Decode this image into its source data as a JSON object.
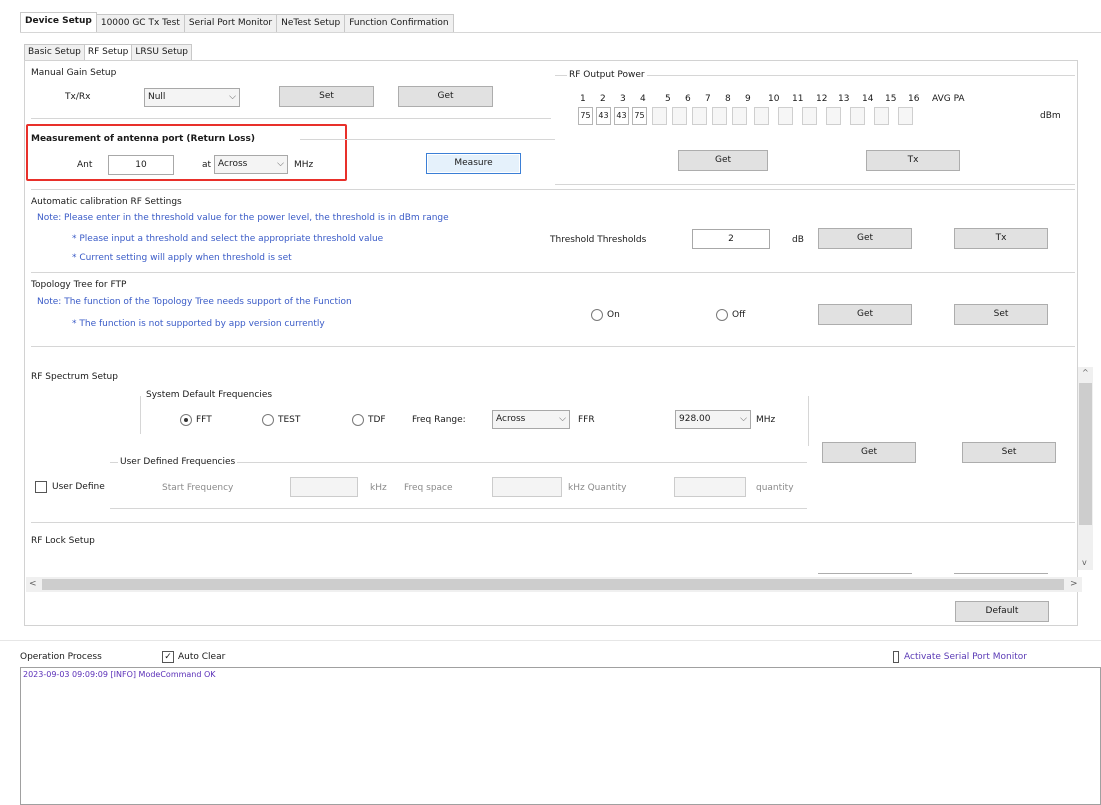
{
  "main_tabs": [
    "Device Setup",
    "10000 GC Tx Test",
    "Serial Port Monitor",
    "NeTest Setup",
    "Function Confirmation"
  ],
  "sub_tabs": [
    "Basic Setup",
    "RF Setup",
    "LRSU Setup"
  ],
  "manual_gain": {
    "title": "Manual Gain Setup",
    "field_label": "Tx/Rx",
    "combo_value": "Null",
    "set_label": "Set",
    "get_label": "Get"
  },
  "output_power": {
    "title": "RF Output Power",
    "numbers": [
      "1",
      "2",
      "3",
      "4",
      "5",
      "6",
      "7",
      "8",
      "9",
      "10",
      "11",
      "12",
      "13",
      "14",
      "15",
      "16"
    ],
    "last_label": "AVG PA",
    "unit": "dBm",
    "values": [
      "75",
      "43",
      "43",
      "75",
      "",
      "",
      "",
      "",
      "",
      "",
      "",
      "",
      "",
      "",
      "",
      ""
    ],
    "get_label": "Get",
    "set_label": "Tx"
  },
  "measurement": {
    "title": "Measurement of antenna port (Return Loss)",
    "prefix": "Ant",
    "value": "10",
    "at_label": "at",
    "combo_value": "Across",
    "unit": "MHz",
    "button": "Measure"
  },
  "automatic": {
    "title": "Automatic calibration RF Settings",
    "note_prefix": "Note:",
    "note1": "Please enter in the threshold value for the power level, the threshold is in dBm range",
    "note2": "* Please input a threshold and select the appropriate threshold value",
    "note3": "* Current setting will apply when threshold is set",
    "threshold_label": "Threshold Thresholds",
    "threshold_value": "2",
    "threshold_unit": "dB",
    "get_label": "Get",
    "set_label": "Tx"
  },
  "topology": {
    "title": "Topology Tree for FTP",
    "note1": "Note: The function of the Topology Tree needs support of the Function",
    "note2": "* The function is not supported by app version currently",
    "on_label": "On",
    "off_label": "Off",
    "get_label": "Get",
    "set_label": "Set"
  },
  "spectrum": {
    "title": "RF Spectrum Setup",
    "default_freq_title": "System Default Frequencies",
    "opt1": "FFT",
    "opt2": "TEST",
    "opt3": "TDF",
    "range_label": "Freq Range:",
    "range_value": "Across",
    "ffr_label": "FFR",
    "freq_value": "928.00",
    "freq_unit": "MHz",
    "user_freq_title": "User Defined Frequencies",
    "user_checkbox": "User Define",
    "start_label": "Start Frequency",
    "start_unit": "kHz",
    "space_label": "Freq space",
    "space_unit": "kHz Quantity",
    "qty_unit": "quantity",
    "get_label": "Get",
    "set_label": "Set"
  },
  "rf_lock": {
    "title": "RF Lock Setup"
  },
  "default_button": "Default",
  "operation": {
    "label": "Operation Process",
    "autoclear": "Auto Clear",
    "activate": "Activate Serial Port Monitor",
    "log_line": "2023-09-03 09:09:09 [INFO] ModeCommand OK"
  }
}
